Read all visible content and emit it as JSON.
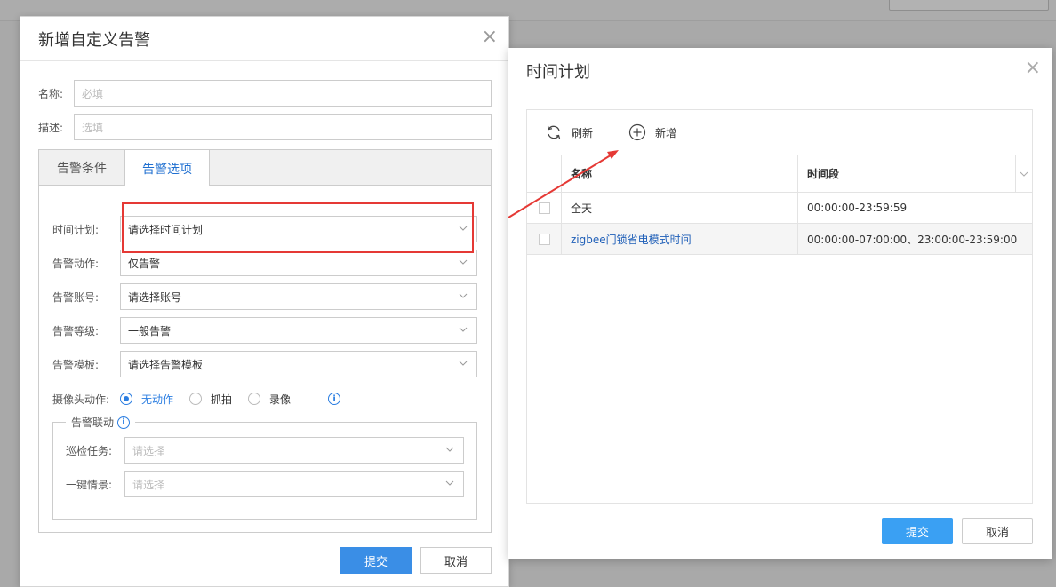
{
  "dialog_main": {
    "title": "新增自定义告警",
    "close_glyph": "×",
    "name_label": "名称:",
    "name_placeholder": "必填",
    "desc_label": "描述:",
    "desc_placeholder": "选填",
    "tabs": [
      {
        "label": "告警条件"
      },
      {
        "label": "告警选项"
      }
    ],
    "options": [
      {
        "label": "时间计划:",
        "value": "请选择时间计划"
      },
      {
        "label": "告警动作:",
        "value": "仅告警"
      },
      {
        "label": "告警账号:",
        "value": "请选择账号"
      },
      {
        "label": "告警等级:",
        "value": "一般告警"
      },
      {
        "label": "告警模板:",
        "value": "请选择告警模板"
      }
    ],
    "camera_action_label": "摄像头动作:",
    "camera_actions": [
      {
        "label": "无动作",
        "selected": true
      },
      {
        "label": "抓拍",
        "selected": false
      },
      {
        "label": "录像",
        "selected": false
      }
    ],
    "linkage": {
      "legend": "告警联动",
      "rows": [
        {
          "label": "巡检任务:",
          "placeholder": "请选择"
        },
        {
          "label": "一键情景:",
          "placeholder": "请选择"
        }
      ]
    },
    "submit_label": "提交",
    "cancel_label": "取消"
  },
  "dialog_schedule": {
    "title": "时间计划",
    "close_glyph": "×",
    "toolbar": {
      "refresh_label": "刷新",
      "add_label": "新增"
    },
    "columns": [
      "名称",
      "时间段"
    ],
    "rows": [
      {
        "name": "全天",
        "period": "00:00:00-23:59:59",
        "link": false
      },
      {
        "name": "zigbee门锁省电模式时间",
        "period": "00:00:00-07:00:00、23:00:00-23:59:00",
        "link": true
      }
    ],
    "submit_label": "提交",
    "cancel_label": "取消"
  },
  "colors": {
    "primary": "#3a8ee6",
    "highlight_red": "#e53935",
    "link_blue": "#1f5fb8"
  }
}
